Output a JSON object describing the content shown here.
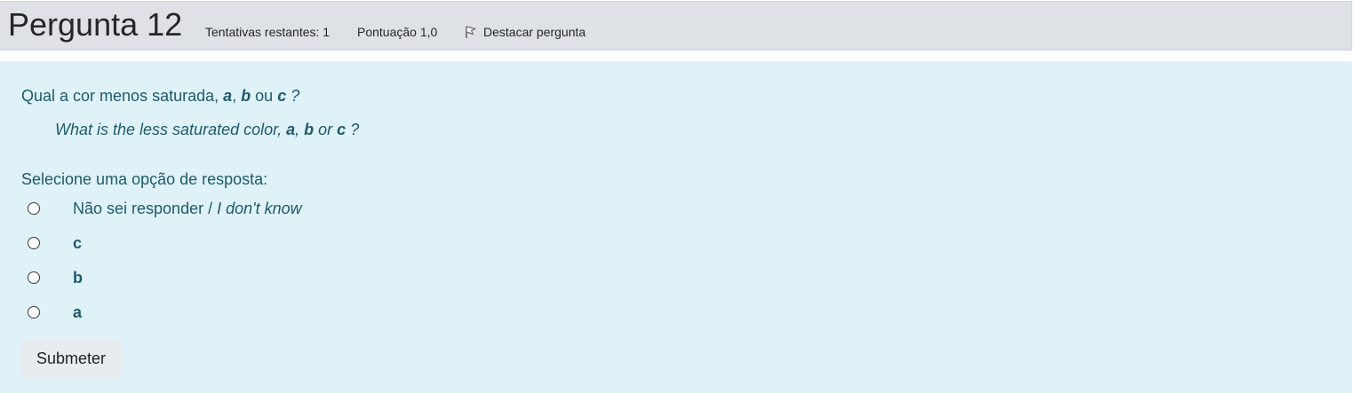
{
  "header": {
    "title": "Pergunta 12",
    "attempts": "Tentativas restantes: 1",
    "grade": "Pontuação 1,0",
    "flag_label": "Destacar pergunta",
    "flag_icon": "flag-icon"
  },
  "question": {
    "pt": {
      "prefix": "Qual a cor menos saturada, ",
      "a": "a",
      "sep1": ", ",
      "b": "b",
      "sep2": " ou ",
      "c": "c",
      "suffix": " ?"
    },
    "en": {
      "prefix": "What is the less saturated color, ",
      "a": "a",
      "sep1": ", ",
      "b": "b",
      "sep2": " or ",
      "c": "c",
      "suffix": " ?"
    }
  },
  "prompt": "Selecione uma opção de resposta:",
  "options": [
    {
      "pt": "Não sei responder / ",
      "en": "I don't know"
    },
    {
      "label": "c"
    },
    {
      "label": "b"
    },
    {
      "label": "a"
    }
  ],
  "submit_label": "Submeter",
  "colors": {
    "header_bg": "#dee2e6",
    "content_bg": "#def2f8",
    "text_teal": "#1f5a6b"
  }
}
